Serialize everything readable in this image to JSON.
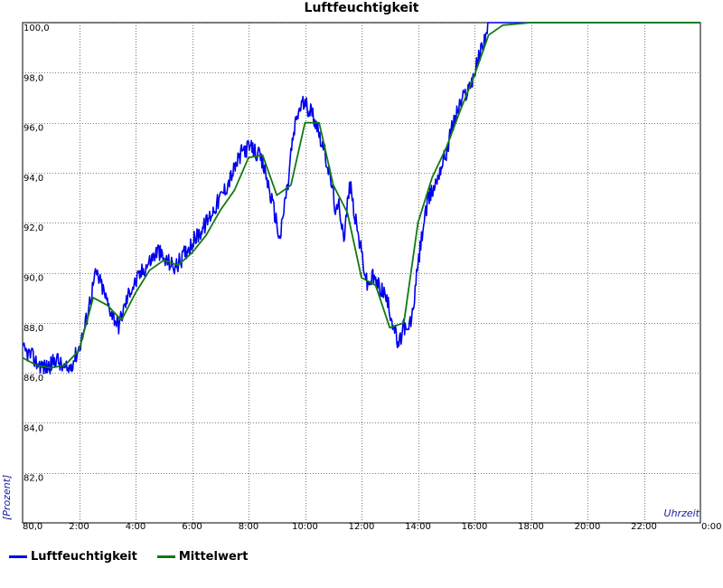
{
  "chart_data": {
    "type": "line",
    "title": "Luftfeuchtigkeit",
    "ylabel": "[Prozent]",
    "xlabel": "Uhrzeit",
    "xlim": [
      0,
      24
    ],
    "ylim": [
      80,
      100
    ],
    "x_ticks": [
      {
        "v": 0,
        "label": "0:00"
      },
      {
        "v": 2,
        "label": "2:00"
      },
      {
        "v": 4,
        "label": "4:00"
      },
      {
        "v": 6,
        "label": "6:00"
      },
      {
        "v": 8,
        "label": "8:00"
      },
      {
        "v": 10,
        "label": "10:00"
      },
      {
        "v": 12,
        "label": "12:00"
      },
      {
        "v": 14,
        "label": "14:00"
      },
      {
        "v": 16,
        "label": "16:00"
      },
      {
        "v": 18,
        "label": "18:00"
      },
      {
        "v": 20,
        "label": "20:00"
      },
      {
        "v": 22,
        "label": "22:00"
      },
      {
        "v": 24,
        "label": "0:00"
      }
    ],
    "y_ticks": [
      {
        "v": 80,
        "label": "80,0"
      },
      {
        "v": 82,
        "label": "82,0"
      },
      {
        "v": 84,
        "label": "84,0"
      },
      {
        "v": 86,
        "label": "86,0"
      },
      {
        "v": 88,
        "label": "88,0"
      },
      {
        "v": 90,
        "label": "90,0"
      },
      {
        "v": 92,
        "label": "92,0"
      },
      {
        "v": 94,
        "label": "94,0"
      },
      {
        "v": 96,
        "label": "96,0"
      },
      {
        "v": 98,
        "label": "98,0"
      },
      {
        "v": 100,
        "label": "100,0"
      }
    ],
    "grid": true,
    "legend_position": "bottom-left",
    "series": [
      {
        "name": "Luftfeuchtigkeit",
        "color": "#0000ee",
        "x": [
          0,
          0.3,
          0.5,
          0.8,
          1.0,
          1.2,
          1.4,
          1.6,
          1.8,
          2.0,
          2.2,
          2.4,
          2.6,
          2.8,
          3.0,
          3.2,
          3.4,
          3.6,
          3.8,
          4.0,
          4.2,
          4.4,
          4.6,
          4.8,
          5.0,
          5.2,
          5.4,
          5.6,
          5.8,
          6.0,
          6.2,
          6.4,
          6.6,
          6.8,
          7.0,
          7.2,
          7.4,
          7.6,
          7.8,
          8.0,
          8.2,
          8.4,
          8.6,
          8.8,
          9.0,
          9.1,
          9.2,
          9.3,
          9.4,
          9.5,
          9.7,
          9.9,
          10.0,
          10.2,
          10.4,
          10.6,
          10.8,
          11.0,
          11.1,
          11.2,
          11.4,
          11.5,
          11.6,
          11.8,
          12.0,
          12.2,
          12.4,
          12.6,
          12.8,
          13.0,
          13.2,
          13.3,
          13.4,
          13.5,
          13.6,
          13.8,
          14.0,
          14.2,
          14.4,
          14.6,
          14.8,
          15.0,
          15.2,
          15.4,
          15.6,
          15.8,
          16.0,
          16.2,
          16.4,
          16.5,
          16.7,
          17.0,
          18.0,
          19.0,
          20.0,
          21.0,
          22.0,
          23.0,
          24.0
        ],
        "values": [
          86.9,
          86.7,
          86.4,
          86.2,
          86.3,
          86.6,
          86.2,
          86.1,
          86.5,
          87.0,
          87.8,
          89.0,
          90.0,
          89.5,
          88.8,
          88.3,
          87.9,
          88.6,
          89.3,
          89.6,
          90.0,
          90.3,
          90.6,
          90.9,
          90.5,
          90.4,
          90.2,
          90.5,
          90.9,
          91.2,
          91.5,
          91.8,
          92.2,
          92.6,
          93.0,
          93.4,
          93.9,
          94.4,
          94.9,
          95.0,
          94.9,
          94.6,
          94.0,
          93.0,
          92.0,
          91.3,
          92.0,
          93.0,
          93.5,
          94.8,
          96.2,
          96.8,
          96.7,
          96.5,
          96.0,
          95.2,
          94.3,
          93.2,
          92.3,
          92.7,
          91.4,
          92.8,
          93.5,
          92.0,
          90.8,
          89.5,
          89.8,
          89.5,
          89.2,
          88.5,
          87.6,
          87.0,
          87.4,
          88.0,
          87.5,
          88.3,
          90.3,
          92.0,
          93.0,
          93.5,
          94.2,
          94.8,
          95.8,
          96.5,
          97.0,
          97.4,
          98.0,
          98.8,
          99.5,
          100.0,
          100.0,
          100.0,
          100.0,
          100.0,
          100.0,
          100.0,
          100.0,
          100.0,
          100.0
        ]
      },
      {
        "name": "Mittelwert",
        "color": "#107a10",
        "x": [
          0,
          0.5,
          1.0,
          1.5,
          2.0,
          2.5,
          3.0,
          3.5,
          4.0,
          4.5,
          5.0,
          5.5,
          6.0,
          6.5,
          7.0,
          7.5,
          8.0,
          8.5,
          9.0,
          9.5,
          10.0,
          10.5,
          11.0,
          11.5,
          12.0,
          12.5,
          13.0,
          13.5,
          14.0,
          14.5,
          15.0,
          15.5,
          16.0,
          16.5,
          17.0,
          18.0,
          20.0,
          22.0,
          24.0
        ],
        "values": [
          86.6,
          86.3,
          86.2,
          86.3,
          86.9,
          89.0,
          88.7,
          88.1,
          89.2,
          90.1,
          90.5,
          90.3,
          90.8,
          91.5,
          92.5,
          93.3,
          94.6,
          94.7,
          93.1,
          93.5,
          96.0,
          96.0,
          93.5,
          92.4,
          89.8,
          89.5,
          87.8,
          88.0,
          92.0,
          93.8,
          95.0,
          96.5,
          97.9,
          99.5,
          99.9,
          100.0,
          100.0,
          100.0,
          100.0
        ]
      }
    ]
  }
}
